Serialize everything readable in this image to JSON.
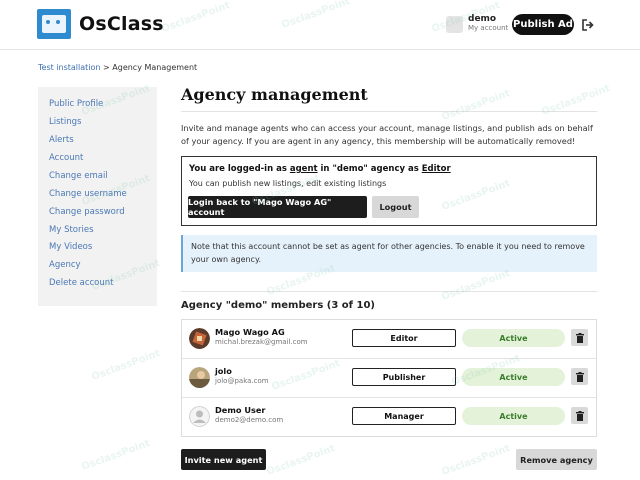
{
  "header": {
    "logo_text": "OsClass",
    "user_name": "demo",
    "user_sub": "My account",
    "publish_label": "Publish Ad",
    "logout_icon": "logout-icon"
  },
  "breadcrumb": {
    "root": "Test installation",
    "separator": " > ",
    "current": "Agency Management"
  },
  "sidebar": {
    "items": [
      {
        "label": "Public Profile"
      },
      {
        "label": "Listings"
      },
      {
        "label": "Alerts"
      },
      {
        "label": "Account"
      },
      {
        "label": "Change email"
      },
      {
        "label": "Change username"
      },
      {
        "label": "Change password"
      },
      {
        "label": "My Stories"
      },
      {
        "label": "My Videos"
      },
      {
        "label": "Agency"
      },
      {
        "label": "Delete account"
      }
    ]
  },
  "main": {
    "title": "Agency management",
    "intro": "Invite and manage agents who can access your account, manage listings, and publish ads on behalf of your agency. If you are agent in any agency, this membership will be automatically removed!",
    "login_box": {
      "line1_a": "You are logged-in as ",
      "line1_agent": "agent",
      "line1_b": " in \"demo\" agency as ",
      "line1_role": "Editor",
      "line2": "You can publish new listings, edit existing listings",
      "login_back_label": "Login back to \"Mago Wago AG\" account",
      "logout_label": "Logout"
    },
    "note": "Note that this account cannot be set as agent for other agencies. To enable it you need to remove your own agency.",
    "members_title": "Agency \"demo\" members (3 of 10)",
    "members": [
      {
        "name": "Mago Wago AG",
        "email": "michal.brezak@gmail.com",
        "role": "Editor",
        "status": "Active"
      },
      {
        "name": "jolo",
        "email": "jolo@paka.com",
        "role": "Publisher",
        "status": "Active"
      },
      {
        "name": "Demo User",
        "email": "demo2@demo.com",
        "role": "Manager",
        "status": "Active"
      }
    ],
    "invite_label": "Invite new agent",
    "remove_label": "Remove agency"
  },
  "watermark": "OsclassPoint",
  "colors": {
    "accent": "#2f8bd0",
    "link": "#4a78b5",
    "dark_button": "#1d1d1d",
    "active_bg": "#e3f2d9",
    "note_bg": "#e6f2fb"
  }
}
